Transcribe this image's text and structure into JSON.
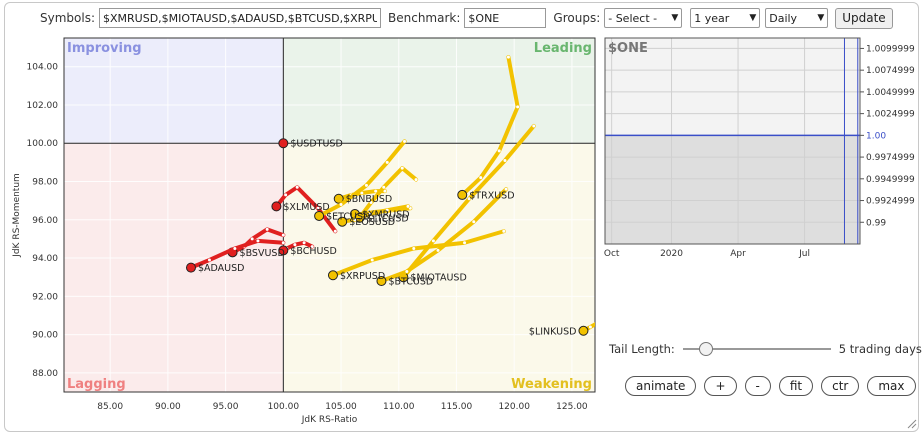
{
  "toolbar": {
    "symbols_label": "Symbols:",
    "symbols_value": "$XMRUSD,$MIOTAUSD,$ADAUSD,$BTCUSD,$XRPUSD",
    "benchmark_label": "Benchmark:",
    "benchmark_value": "$ONE",
    "groups_label": "Groups:",
    "groups_select": "- Select -",
    "period_select": "1 year",
    "interval_select": "Daily",
    "update_button": "Update"
  },
  "chart_data": [
    {
      "type": "scatter",
      "title": "",
      "xlabel": "JdK RS-Ratio",
      "ylabel": "JdK RS-Momentum",
      "xlim": [
        81,
        127
      ],
      "ylim": [
        87,
        105.5
      ],
      "x_ticks": [
        "85.00",
        "90.00",
        "95.00",
        "100.00",
        "105.00",
        "110.00",
        "115.00",
        "120.00",
        "125.00"
      ],
      "y_ticks": [
        "88.00",
        "90.00",
        "92.00",
        "94.00",
        "96.00",
        "98.00",
        "100.00",
        "102.00",
        "104.00"
      ],
      "center": [
        100,
        100
      ],
      "quadrants": {
        "improving": "Improving",
        "leading": "Leading",
        "lagging": "Lagging",
        "weakening": "Weakening"
      },
      "quadrant_colors": {
        "improving": "#ecedfb",
        "leading": "#eaf3ea",
        "lagging": "#fbebeb",
        "weakening": "#fbf9ea"
      },
      "tail_length_days": 5,
      "series": [
        {
          "name": "$USDTUSD",
          "color": "#e02020",
          "points": [
            [
              100,
              100
            ]
          ]
        },
        {
          "name": "$XLMUSD",
          "color": "#e02020",
          "points": [
            [
              104.5,
              95.4
            ],
            [
              103.0,
              96.6
            ],
            [
              101.2,
              97.7
            ],
            [
              100.2,
              97.3
            ],
            [
              99.4,
              96.7
            ]
          ]
        },
        {
          "name": "$BSVUSD",
          "color": "#e02020",
          "points": [
            [
              100.0,
              95.2
            ],
            [
              98.6,
              95.5
            ],
            [
              97.3,
              95.0
            ],
            [
              96.6,
              94.6
            ],
            [
              95.6,
              94.3
            ]
          ]
        },
        {
          "name": "$ADAUSD",
          "color": "#e02020",
          "points": [
            [
              100.0,
              94.8
            ],
            [
              97.8,
              94.9
            ],
            [
              95.8,
              94.5
            ],
            [
              93.6,
              93.9
            ],
            [
              92.0,
              93.5
            ]
          ]
        },
        {
          "name": "$BCHUSD",
          "color": "#e02020",
          "points": [
            [
              102.5,
              94.6
            ],
            [
              101.8,
              94.8
            ],
            [
              101.0,
              94.7
            ],
            [
              100.3,
              94.5
            ],
            [
              100.0,
              94.4
            ]
          ]
        },
        {
          "name": "$BNBUSD",
          "color": "#f2c200",
          "points": [
            [
              108.8,
              97.5
            ],
            [
              108.0,
              97.5
            ],
            [
              106.8,
              97.4
            ],
            [
              105.9,
              97.3
            ],
            [
              104.8,
              97.1
            ]
          ]
        },
        {
          "name": "$ETCUSD",
          "color": "#f2c200",
          "points": [
            [
              110.5,
              100.1
            ],
            [
              109.0,
              99.0
            ],
            [
              107.2,
              97.8
            ],
            [
              105.0,
              96.8
            ],
            [
              103.1,
              96.2
            ]
          ]
        },
        {
          "name": "$XMRUSD",
          "color": "#f2c200",
          "points": [
            [
              111.0,
              96.6
            ],
            [
              109.4,
              96.5
            ],
            [
              107.8,
              96.4
            ],
            [
              107.0,
              96.3
            ],
            [
              106.2,
              96.3
            ]
          ]
        },
        {
          "name": "$LTCUSD",
          "color": "#f2c200",
          "points": [
            [
              111.5,
              98.1
            ],
            [
              110.3,
              98.7
            ],
            [
              108.7,
              97.7
            ],
            [
              107.6,
              96.9
            ],
            [
              106.6,
              96.1
            ]
          ]
        },
        {
          "name": "$EOSUSD",
          "color": "#f2c200",
          "points": [
            [
              110.8,
              96.7
            ],
            [
              109.0,
              96.5
            ],
            [
              107.5,
              96.3
            ],
            [
              106.2,
              96.0
            ],
            [
              105.1,
              95.9
            ]
          ]
        },
        {
          "name": "$TRXUSD",
          "color": "#f2c200",
          "points": [
            [
              119.5,
              104.5
            ],
            [
              120.3,
              101.9
            ],
            [
              118.7,
              99.6
            ],
            [
              117.1,
              98.2
            ],
            [
              115.5,
              97.3
            ]
          ]
        },
        {
          "name": "$XRPUSD",
          "color": "#f2c200",
          "points": [
            [
              119.1,
              95.4
            ],
            [
              115.7,
              94.8
            ],
            [
              111.3,
              94.5
            ],
            [
              107.7,
              93.9
            ],
            [
              104.3,
              93.1
            ]
          ]
        },
        {
          "name": "$MIOTAUSD",
          "color": "#f2c200",
          "points": [
            [
              121.7,
              100.9
            ],
            [
              119.2,
              99.1
            ],
            [
              116.1,
              97.1
            ],
            [
              113.0,
              94.9
            ],
            [
              110.4,
              93.0
            ]
          ]
        },
        {
          "name": "$BTCUSD",
          "color": "#f2c200",
          "points": [
            [
              119.3,
              97.6
            ],
            [
              116.5,
              95.9
            ],
            [
              113.4,
              94.4
            ],
            [
              110.7,
              93.3
            ],
            [
              108.5,
              92.8
            ]
          ]
        },
        {
          "name": "$LINKUSD",
          "color": "#f2c200",
          "points": [
            [
              129.5,
              91.3
            ],
            [
              128.3,
              90.9
            ],
            [
              127.2,
              90.6
            ],
            [
              126.6,
              90.4
            ],
            [
              126.0,
              90.2
            ]
          ]
        }
      ]
    },
    {
      "type": "line",
      "title": "$ONE",
      "x_ticks": [
        "Oct",
        "2020",
        "Apr",
        "Jul"
      ],
      "y_ticks": [
        "1.0099999",
        "1.0074999",
        "1.0049999",
        "1.0024999",
        "1.00",
        "0.9974999",
        "0.9949999",
        "0.9924999",
        "0.99"
      ],
      "ylim": [
        0.9875,
        1.0112
      ],
      "series": [
        {
          "values": [
            1.0,
            1.0
          ]
        }
      ]
    }
  ],
  "tail": {
    "label": "Tail Length:",
    "value_text": "5 trading days"
  },
  "controls": {
    "animate": "animate",
    "plus": "+",
    "minus": "-",
    "fit": "fit",
    "ctr": "ctr",
    "max": "max"
  }
}
